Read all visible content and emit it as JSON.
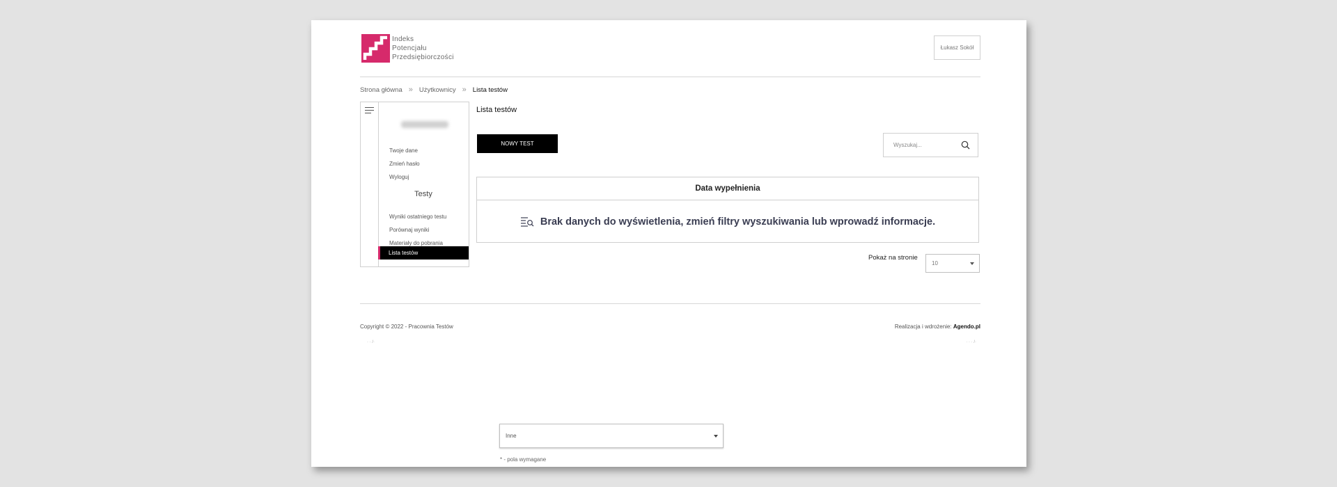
{
  "header": {
    "brand_lines": [
      "Indeks",
      "Potencjału",
      "Przedsiębiorczości"
    ],
    "brand_color": "#d62a6b",
    "user_button": "Łukasz Sokół"
  },
  "breadcrumb": {
    "items": [
      "Strona główna",
      "Użytkownicy"
    ],
    "current": "Lista testów",
    "separator_icon": "double-chevron-right-icon"
  },
  "sidebar": {
    "menu_icon": "hamburger-icon",
    "account_links": [
      "Twoje dane",
      "Zmień hasło",
      "Wyloguj"
    ],
    "section_heading": "Testy",
    "test_links": [
      "Wyniki ostatniego testu",
      "Porównaj wyniki",
      "Materiały do pobrania"
    ],
    "active_link": "Lista testów"
  },
  "main": {
    "title": "Lista testów",
    "new_test_button": "NOWY TEST",
    "search": {
      "placeholder": "Wyszukaj...",
      "icon": "search-icon"
    },
    "table": {
      "columns": [
        "Data wypełnienia"
      ],
      "empty_message": "Brak danych do wyświetlenia, zmień filtry wyszukiwania lub wprowadź informacje.",
      "empty_icon": "search-list-icon"
    },
    "pagination": {
      "label": "Pokaż na stronie",
      "value": "10"
    }
  },
  "footer": {
    "copyright": "Copyright © 2022 - Pracownia Testów",
    "credits_prefix": "Realizacja i wdrożenie:",
    "credits_brand": "Agendo.pl"
  },
  "overlay_form": {
    "select_value": "Inne",
    "required_note": "* - pola wymagane"
  }
}
